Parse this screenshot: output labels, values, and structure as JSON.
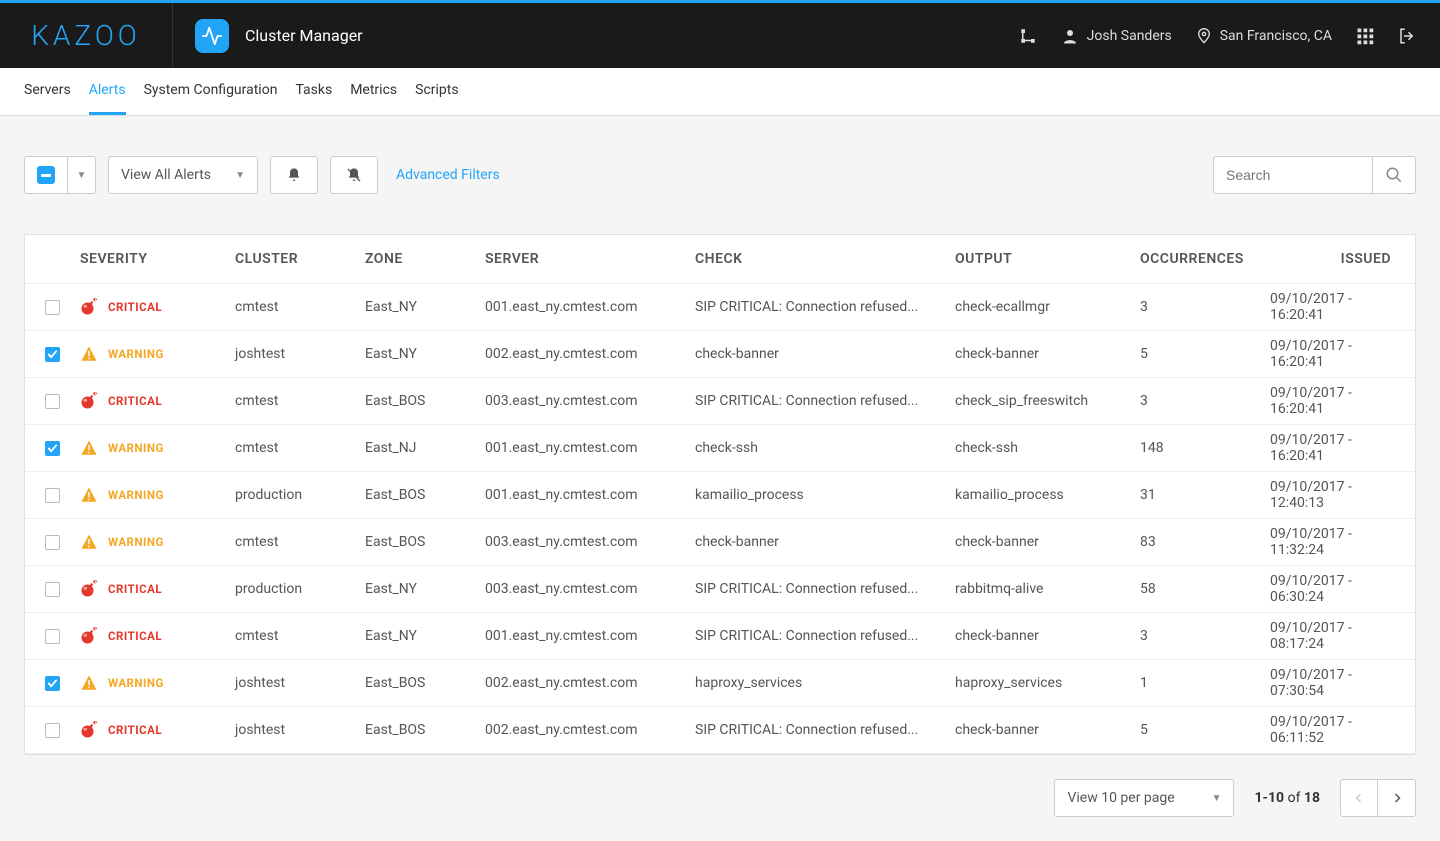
{
  "brand": "KAZOO",
  "app_title": "Cluster Manager",
  "header": {
    "user": "Josh Sanders",
    "location": "San Francisco, CA"
  },
  "tabs": [
    {
      "label": "Servers",
      "active": false
    },
    {
      "label": "Alerts",
      "active": true
    },
    {
      "label": "System Configuration",
      "active": false
    },
    {
      "label": "Tasks",
      "active": false
    },
    {
      "label": "Metrics",
      "active": false
    },
    {
      "label": "Scripts",
      "active": false
    }
  ],
  "toolbar": {
    "view_label": "View All Alerts",
    "advanced_filters": "Advanced Filters",
    "search_placeholder": "Search"
  },
  "columns": {
    "severity": "Severity",
    "cluster": "Cluster",
    "zone": "Zone",
    "server": "Server",
    "check": "Check",
    "output": "Output",
    "occurrences": "Occurrences",
    "issued": "Issued"
  },
  "rows": [
    {
      "checked": false,
      "severity": "CRITICAL",
      "cluster": "cmtest",
      "zone": "East_NY",
      "server": "001.east_ny.cmtest.com",
      "check": "SIP CRITICAL: Connection refused...",
      "output": "check-ecallmgr",
      "occurrences": "3",
      "issued": "09/10/2017 - 16:20:41"
    },
    {
      "checked": true,
      "severity": "WARNING",
      "cluster": "joshtest",
      "zone": "East_NY",
      "server": "002.east_ny.cmtest.com",
      "check": "check-banner",
      "output": "check-banner",
      "occurrences": "5",
      "issued": "09/10/2017 - 16:20:41"
    },
    {
      "checked": false,
      "severity": "CRITICAL",
      "cluster": "cmtest",
      "zone": "East_BOS",
      "server": "003.east_ny.cmtest.com",
      "check": "SIP CRITICAL: Connection refused...",
      "output": "check_sip_freeswitch",
      "occurrences": "3",
      "issued": "09/10/2017 - 16:20:41"
    },
    {
      "checked": true,
      "severity": "WARNING",
      "cluster": "cmtest",
      "zone": "East_NJ",
      "server": "001.east_ny.cmtest.com",
      "check": "check-ssh",
      "output": "check-ssh",
      "occurrences": "148",
      "issued": "09/10/2017 - 16:20:41"
    },
    {
      "checked": false,
      "severity": "WARNING",
      "cluster": "production",
      "zone": "East_BOS",
      "server": "001.east_ny.cmtest.com",
      "check": "kamailio_process",
      "output": "kamailio_process",
      "occurrences": "31",
      "issued": "09/10/2017 - 12:40:13"
    },
    {
      "checked": false,
      "severity": "WARNING",
      "cluster": "cmtest",
      "zone": "East_BOS",
      "server": "003.east_ny.cmtest.com",
      "check": "check-banner",
      "output": "check-banner",
      "occurrences": "83",
      "issued": "09/10/2017 - 11:32:24"
    },
    {
      "checked": false,
      "severity": "CRITICAL",
      "cluster": "production",
      "zone": "East_NY",
      "server": "003.east_ny.cmtest.com",
      "check": "SIP CRITICAL: Connection refused...",
      "output": "rabbitmq-alive",
      "occurrences": "58",
      "issued": "09/10/2017 - 06:30:24"
    },
    {
      "checked": false,
      "severity": "CRITICAL",
      "cluster": "cmtest",
      "zone": "East_NY",
      "server": "001.east_ny.cmtest.com",
      "check": "SIP CRITICAL: Connection refused...",
      "output": "check-banner",
      "occurrences": "3",
      "issued": "09/10/2017 - 08:17:24"
    },
    {
      "checked": true,
      "severity": "WARNING",
      "cluster": "joshtest",
      "zone": "East_BOS",
      "server": "002.east_ny.cmtest.com",
      "check": "haproxy_services",
      "output": "haproxy_services",
      "occurrences": "1",
      "issued": "09/10/2017 - 07:30:54"
    },
    {
      "checked": false,
      "severity": "CRITICAL",
      "cluster": "joshtest",
      "zone": "East_BOS",
      "server": "002.east_ny.cmtest.com",
      "check": "SIP CRITICAL: Connection refused...",
      "output": "check-banner",
      "occurrences": "5",
      "issued": "09/10/2017 - 06:11:52"
    }
  ],
  "pagination": {
    "per_page_label": "View 10 per page",
    "range_text": "1-10",
    "of_text": "of",
    "total": "18"
  }
}
